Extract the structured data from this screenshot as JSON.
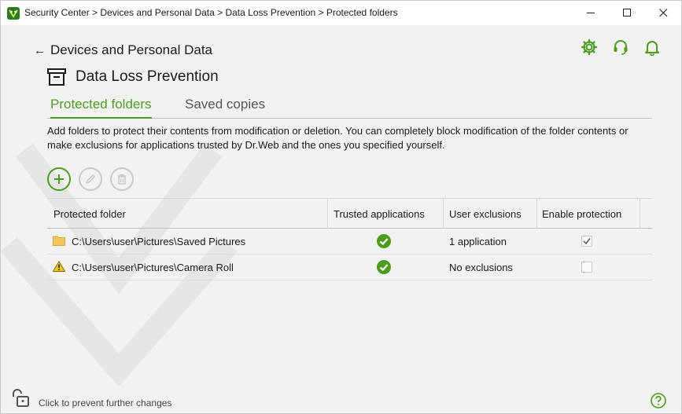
{
  "window": {
    "title": "Security Center > Devices and Personal Data > Data Loss Prevention > Protected folders"
  },
  "nav": {
    "back_label": "Devices and Personal Data"
  },
  "section": {
    "title": "Data Loss Prevention"
  },
  "tabs": [
    {
      "label": "Protected folders",
      "active": true
    },
    {
      "label": "Saved copies",
      "active": false
    }
  ],
  "description": "Add folders to protect their contents from modification or deletion. You can completely block modification of the folder contents or make exclusions for applications trusted by Dr.Web and the ones you specified yourself.",
  "table": {
    "columns": [
      "Protected folder",
      "Trusted applications",
      "User exclusions",
      "Enable protection"
    ],
    "rows": [
      {
        "icon": "folder-icon",
        "path": "C:\\Users\\user\\Pictures\\Saved Pictures",
        "trusted": true,
        "exclusions": "1 application",
        "enabled": true
      },
      {
        "icon": "warning-icon",
        "path": "C:\\Users\\user\\Pictures\\Camera Roll",
        "trusted": true,
        "exclusions": "No exclusions",
        "enabled": false
      }
    ]
  },
  "footer": {
    "lock_text": "Click to prevent further changes"
  },
  "colors": {
    "accent": "#4a9e1c",
    "background": "#f2f2f2"
  }
}
